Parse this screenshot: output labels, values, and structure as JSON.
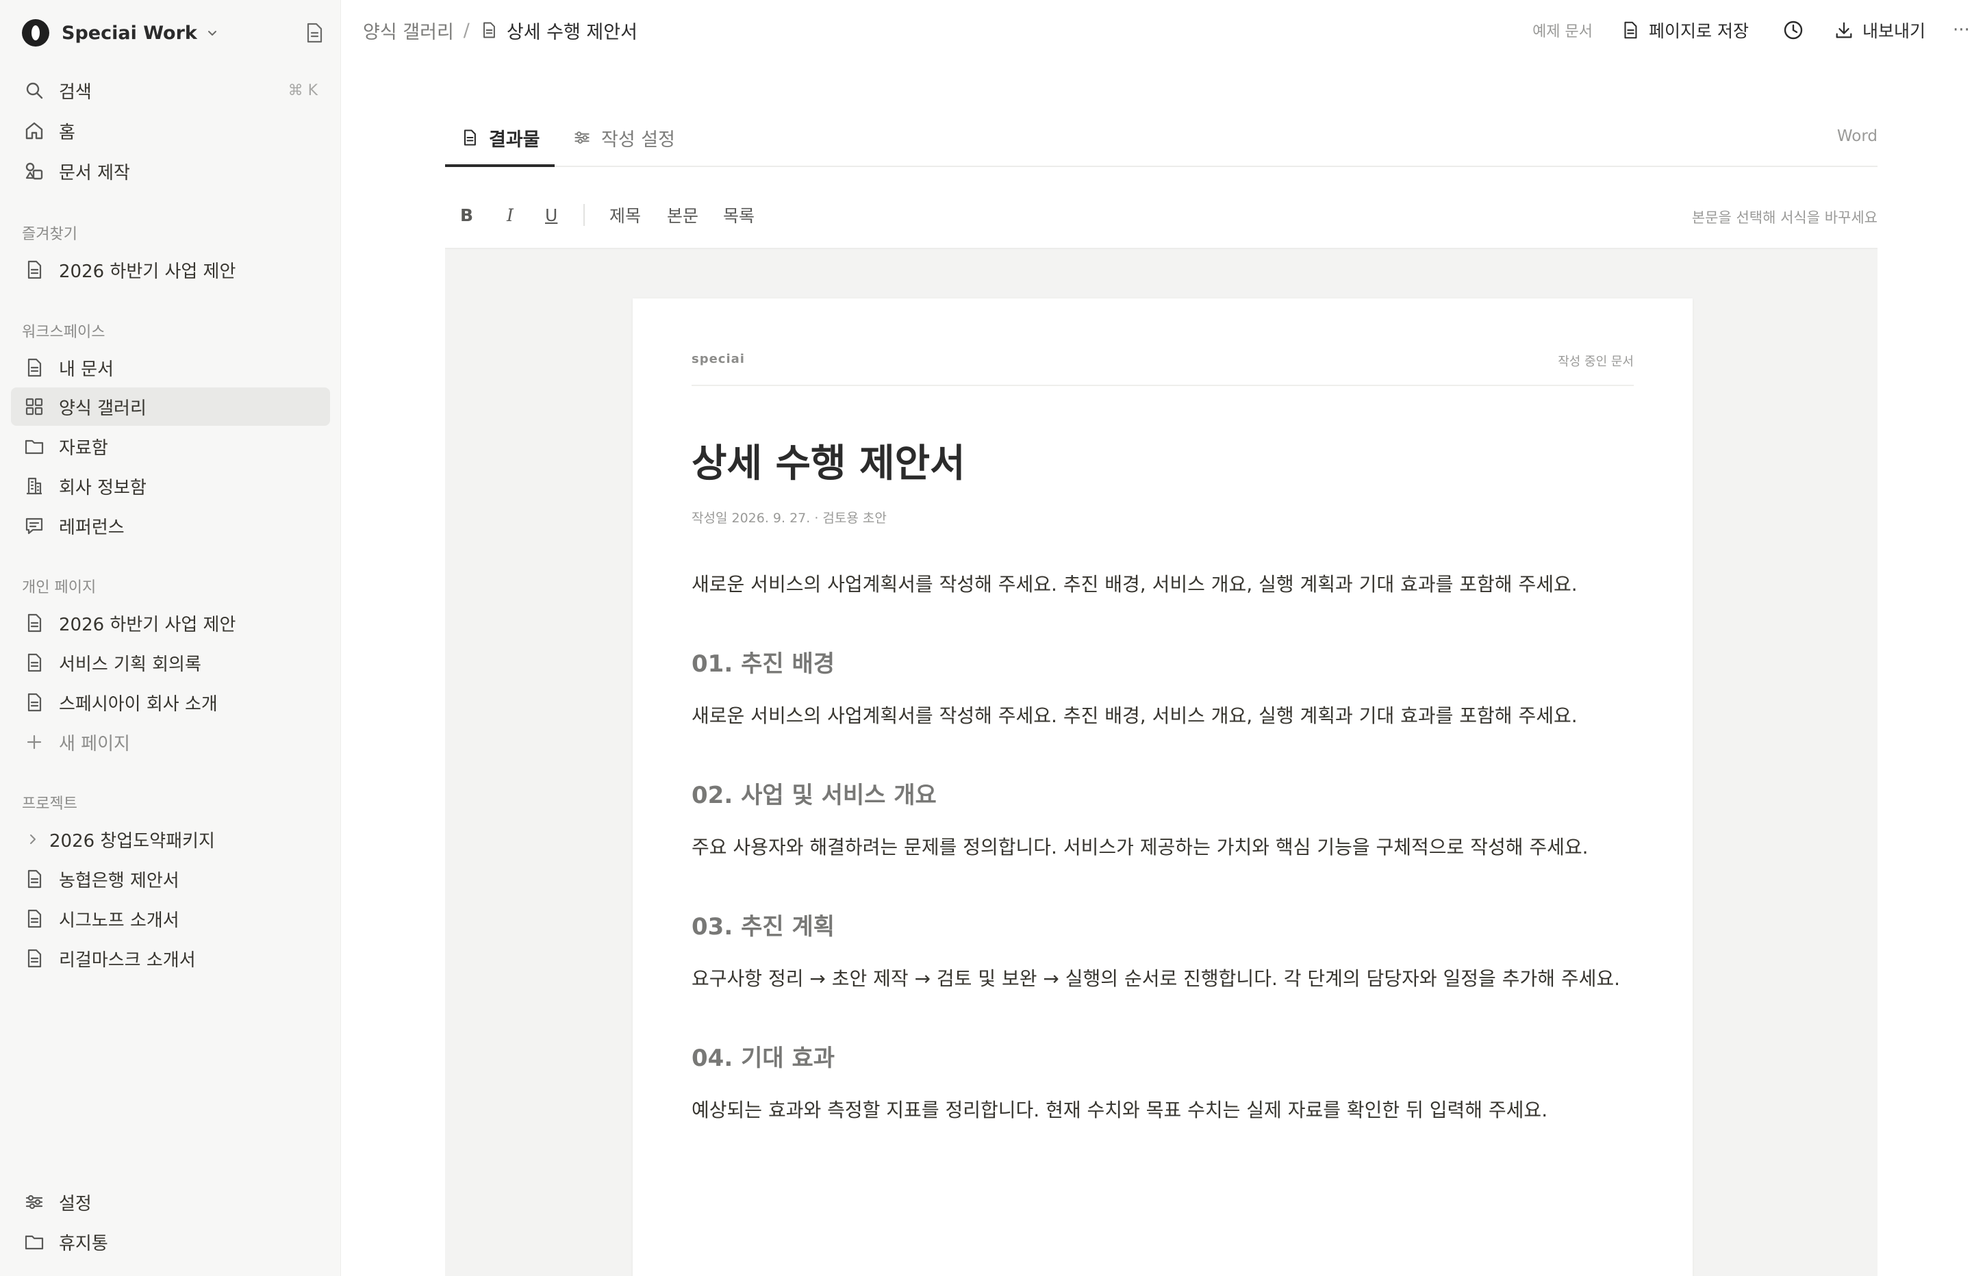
{
  "workspace": {
    "name": "Speciai Work"
  },
  "sidebar": {
    "search": {
      "label": "검색",
      "shortcut": "⌘ K"
    },
    "home": "홈",
    "create_doc": "문서 제작",
    "favorites": {
      "title": "즐겨찾기",
      "items": [
        "2026 하반기 사업 제안"
      ]
    },
    "workspace_section": {
      "title": "워크스페이스",
      "items": [
        "내 문서",
        "양식 갤러리",
        "자료함",
        "회사 정보함",
        "레퍼런스"
      ]
    },
    "personal": {
      "title": "개인 페이지",
      "items": [
        "2026 하반기 사업 제안",
        "서비스 기획 회의록",
        "스페시아이 회사 소개"
      ],
      "new_page": "새 페이지"
    },
    "projects": {
      "title": "프로젝트",
      "folder": "2026 창업도약패키지",
      "items": [
        "농협은행 제안서",
        "시그노프 소개서",
        "리걸마스크 소개서"
      ]
    },
    "footer": {
      "settings": "설정",
      "trash": "휴지통"
    }
  },
  "header": {
    "breadcrumb_parent": "양식 갤러리",
    "breadcrumb_sep": "/",
    "breadcrumb_current": "상세 수행 제안서",
    "example_tag": "예제 문서",
    "save_page": "페이지로 저장",
    "export": "내보내기",
    "more": "···"
  },
  "tabs": {
    "result": "결과물",
    "settings": "작성 설정",
    "format": "Word"
  },
  "format_bar": {
    "bold": "B",
    "italic": "I",
    "underline": "U",
    "heading": "제목",
    "body": "본문",
    "list": "목록",
    "hint": "본문을 선택해 서식을 바꾸세요"
  },
  "document": {
    "brand": "speciai",
    "status": "작성 중인 문서",
    "title": "상세 수행 제안서",
    "meta": "작성일 2026. 9. 27. · 검토용 초안",
    "intro": "새로운 서비스의 사업계획서를 작성해 주세요. 추진 배경, 서비스 개요, 실행 계획과 기대 효과를 포함해 주세요.",
    "sections": [
      {
        "heading": "01. 추진 배경",
        "body": "새로운 서비스의 사업계획서를 작성해 주세요. 추진 배경, 서비스 개요, 실행 계획과 기대 효과를 포함해 주세요."
      },
      {
        "heading": "02. 사업 및 서비스 개요",
        "body": "주요 사용자와 해결하려는 문제를 정의합니다. 서비스가 제공하는 가치와 핵심 기능을 구체적으로 작성해 주세요."
      },
      {
        "heading": "03. 추진 계획",
        "body": "요구사항 정리 → 초안 제작 → 검토 및 보완 → 실행의 순서로 진행합니다. 각 단계의 담당자와 일정을 추가해 주세요."
      },
      {
        "heading": "04. 기대 효과",
        "body": "예상되는 효과와 측정할 지표를 정리합니다. 현재 수치와 목표 수치는 실제 자료를 확인한 뒤 입력해 주세요."
      }
    ]
  }
}
